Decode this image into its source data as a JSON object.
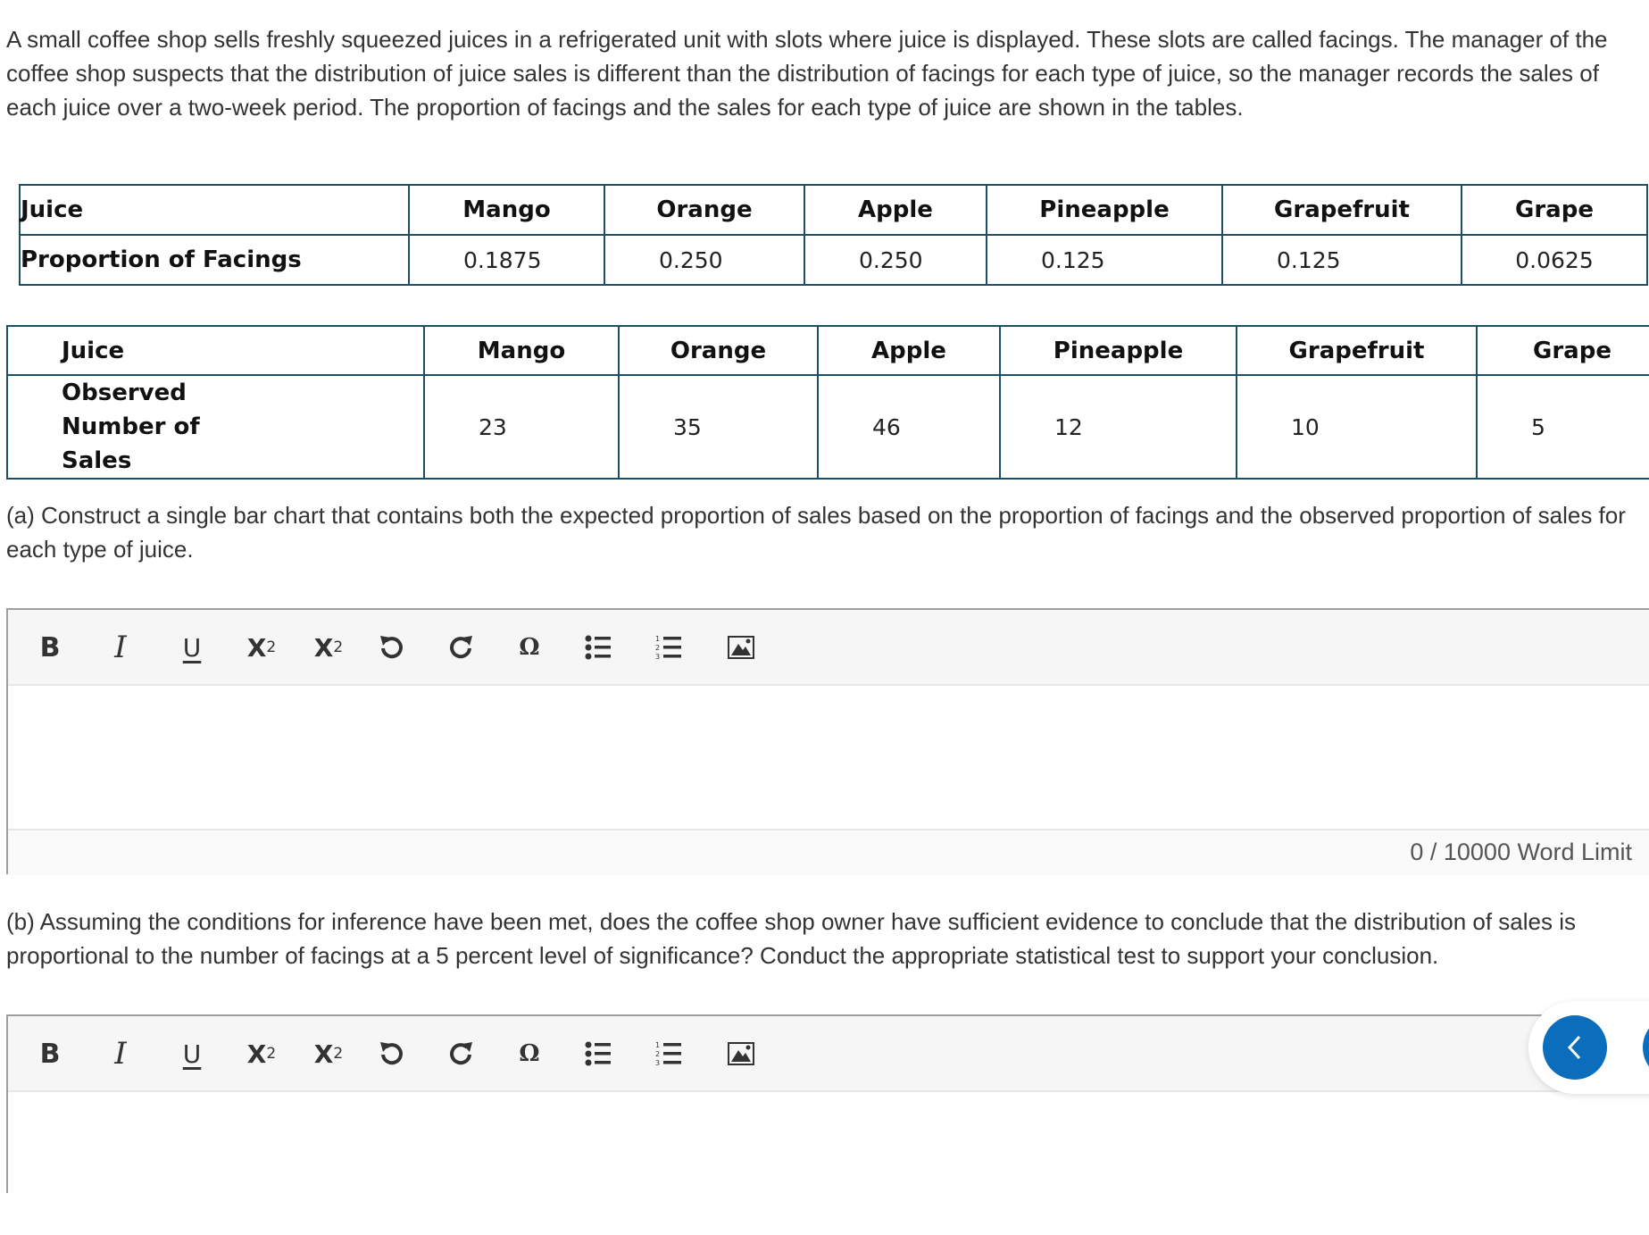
{
  "intro": "A small coffee shop sells freshly squeezed juices in a refrigerated unit with slots where juice is displayed. These slots are called facings. The manager of the coffee shop suspects that the distribution of juice sales is different than the distribution of facings for each type of juice, so the manager records the sales of each juice over a two-week period. The proportion of facings and the sales for each type of juice are shown in the tables.",
  "facings_table": {
    "header_label": "Juice",
    "row_label": "Proportion of Facings",
    "juices": [
      "Mango",
      "Orange",
      "Apple",
      "Pineapple",
      "Grapefruit",
      "Grape"
    ],
    "values": [
      "0.1875",
      "0.250",
      "0.250",
      "0.125",
      "0.125",
      "0.0625"
    ]
  },
  "sales_table": {
    "header_label": "Juice",
    "row_label": "Observed Number of Sales",
    "juices": [
      "Mango",
      "Orange",
      "Apple",
      "Pineapple",
      "Grapefruit",
      "Grape"
    ],
    "values": [
      "23",
      "35",
      "46",
      "12",
      "10",
      "5"
    ]
  },
  "part_a": "(a) Construct a single bar chart that contains both the expected proportion of sales based on the proportion of facings and the observed proportion of sales for each type of juice.",
  "part_b": "(b) Assuming the conditions for inference have been met, does the coffee shop owner have sufficient evidence to conclude that the distribution of sales is proportional to the number of facings at a 5 percent level of significance? Conduct the appropriate statistical test to support your conclusion.",
  "editor_a": {
    "toolbar": {
      "bold": "B",
      "italic": "I",
      "underline": "U",
      "superscript_base": "X",
      "superscript_exp": "2",
      "subscript_base": "X",
      "subscript_idx": "2",
      "special_char": "Ω"
    },
    "content": "",
    "word_limit": "0 / 10000 Word Limit"
  },
  "editor_b": {
    "toolbar": {
      "bold": "B",
      "italic": "I",
      "underline": "U",
      "superscript_base": "X",
      "superscript_exp": "2",
      "subscript_base": "X",
      "subscript_idx": "2",
      "special_char": "Ω"
    },
    "content": ""
  },
  "nav": {
    "prev_icon": "chevron-left-icon",
    "next_icon": "chevron-right-icon",
    "accent_color": "#0a6ebd"
  }
}
